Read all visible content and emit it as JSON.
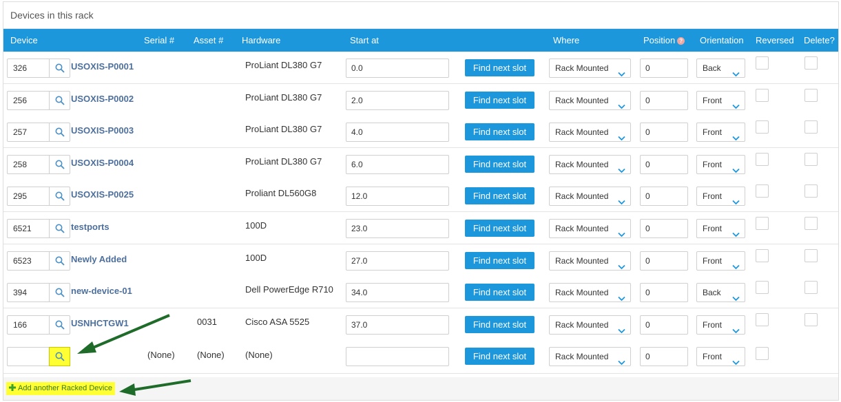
{
  "panel": {
    "title": "Devices in this rack"
  },
  "columns": {
    "device": "Device",
    "serial": "Serial #",
    "asset": "Asset #",
    "hardware": "Hardware",
    "start_at": "Start at",
    "where": "Where",
    "position": "Position",
    "position_help": "?",
    "orientation": "Orientation",
    "reversed": "Reversed",
    "delete": "Delete?"
  },
  "rows": [
    {
      "id": "326",
      "name": "USOXIS-P0001",
      "serial": "",
      "asset": "",
      "hardware": "ProLiant DL380 G7",
      "start_at": "0.0",
      "find": "Find next slot",
      "where": "Rack Mounted",
      "position": "0",
      "orientation": "Back"
    },
    {
      "id": "256",
      "name": "USOXIS-P0002",
      "serial": "",
      "asset": "",
      "hardware": "ProLiant DL380 G7",
      "start_at": "2.0",
      "find": "Find next slot",
      "where": "Rack Mounted",
      "position": "0",
      "orientation": "Front"
    },
    {
      "id": "257",
      "name": "USOXIS-P0003",
      "serial": "",
      "asset": "",
      "hardware": "ProLiant DL380 G7",
      "start_at": "4.0",
      "find": "Find next slot",
      "where": "Rack Mounted",
      "position": "0",
      "orientation": "Front"
    },
    {
      "id": "258",
      "name": "USOXIS-P0004",
      "serial": "",
      "asset": "",
      "hardware": "ProLiant DL380 G7",
      "start_at": "6.0",
      "find": "Find next slot",
      "where": "Rack Mounted",
      "position": "0",
      "orientation": "Front"
    },
    {
      "id": "295",
      "name": "USOXIS-P0025",
      "serial": "",
      "asset": "",
      "hardware": "Proliant DL560G8",
      "start_at": "12.0",
      "find": "Find next slot",
      "where": "Rack Mounted",
      "position": "0",
      "orientation": "Front"
    },
    {
      "id": "6521",
      "name": "testports",
      "serial": "",
      "asset": "",
      "hardware": "100D",
      "start_at": "23.0",
      "find": "Find next slot",
      "where": "Rack Mounted",
      "position": "0",
      "orientation": "Front"
    },
    {
      "id": "6523",
      "name": "Newly Added",
      "serial": "",
      "asset": "",
      "hardware": "100D",
      "start_at": "27.0",
      "find": "Find next slot",
      "where": "Rack Mounted",
      "position": "0",
      "orientation": "Front"
    },
    {
      "id": "394",
      "name": "new-device-01",
      "serial": "",
      "asset": "",
      "hardware": "Dell PowerEdge R710",
      "start_at": "34.0",
      "find": "Find next slot",
      "where": "Rack Mounted",
      "position": "0",
      "orientation": "Back"
    },
    {
      "id": "166",
      "name": "USNHCTGW1",
      "serial": "",
      "asset": "0031",
      "hardware": "Cisco ASA 5525",
      "start_at": "37.0",
      "find": "Find next slot",
      "where": "Rack Mounted",
      "position": "0",
      "orientation": "Front"
    }
  ],
  "new_row": {
    "id": "",
    "serial": "(None)",
    "asset": "(None)",
    "hardware": "(None)",
    "start_at": "",
    "find": "Find next slot",
    "where": "Rack Mounted",
    "position": "0",
    "orientation": "Front"
  },
  "footer": {
    "add_label": "Add another Racked Device"
  },
  "colors": {
    "header": "#1d97dc",
    "highlight": "#ffff33",
    "link": "#4d6f9c",
    "arrow": "#1f6b2a"
  }
}
